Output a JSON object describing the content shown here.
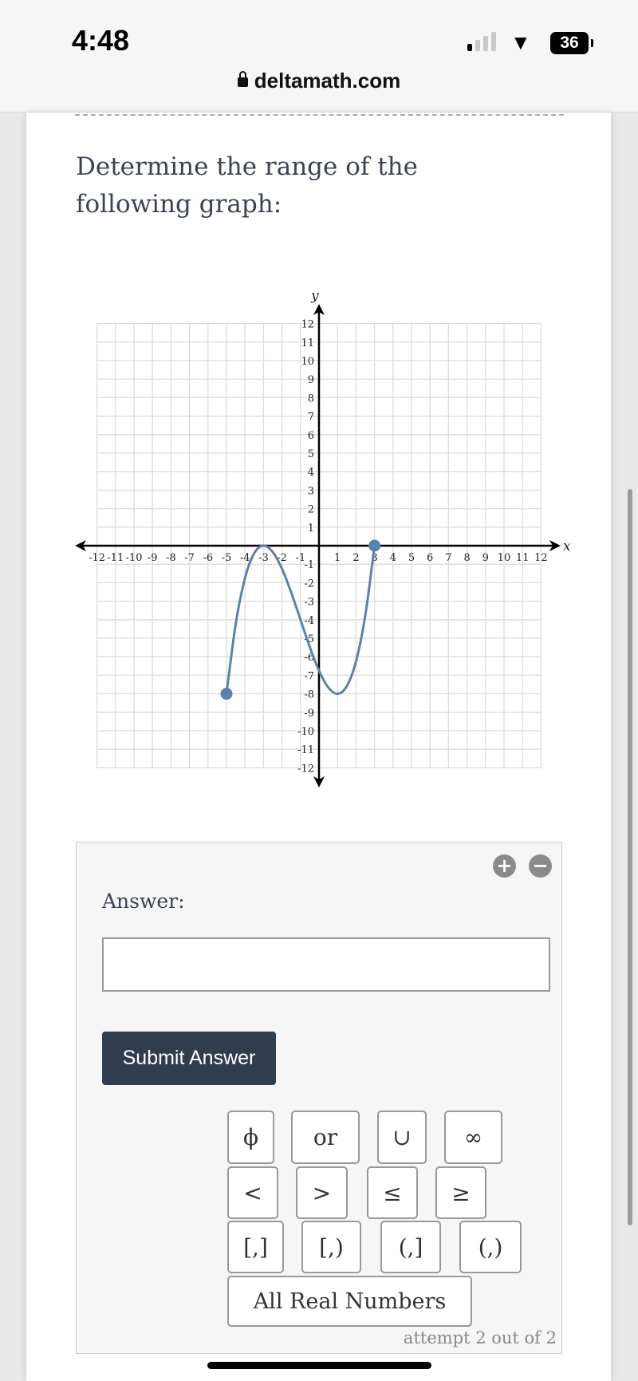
{
  "status_bar": {
    "time": "4:48",
    "battery": "36",
    "signal_icon": "cellular-signal-icon",
    "wifi_icon": "wifi-icon"
  },
  "browser": {
    "url": "deltamath.com",
    "lock_icon": "lock-icon"
  },
  "question": {
    "text": "Determine the range of the following graph:"
  },
  "chart_data": {
    "type": "line",
    "xlabel": "x",
    "ylabel": "y",
    "xlim": [
      -12,
      12
    ],
    "ylim": [
      -12,
      12
    ],
    "grid": true,
    "x_ticks": [
      -12,
      -11,
      -10,
      -9,
      -8,
      -7,
      -6,
      -5,
      -4,
      -3,
      -2,
      -1,
      1,
      2,
      3,
      4,
      5,
      6,
      7,
      8,
      9,
      10,
      11,
      12
    ],
    "y_ticks": [
      -12,
      -11,
      -10,
      -9,
      -8,
      -7,
      -6,
      -5,
      -4,
      -3,
      -2,
      -1,
      1,
      2,
      3,
      4,
      5,
      6,
      7,
      8,
      9,
      10,
      11,
      12
    ],
    "curve_color": "#5b82ad",
    "series": [
      {
        "x": [
          -5,
          -4.5,
          -4,
          -3.5,
          -3,
          -2.5,
          -2,
          -1.5,
          -1,
          -0.5,
          0,
          0.5,
          1,
          1.5,
          2,
          2.5,
          3
        ],
        "y": [
          -8,
          -4.219,
          -1.75,
          -0.406,
          0,
          -0.344,
          -1.25,
          -2.531,
          -4,
          -5.469,
          -6.75,
          -7.656,
          -8,
          -7.594,
          -6.25,
          -3.781,
          0
        ]
      }
    ],
    "endpoints": [
      {
        "x": -5,
        "y": -8,
        "closed": true
      },
      {
        "x": 3,
        "y": 0,
        "closed": true
      }
    ]
  },
  "answer": {
    "label": "Answer:",
    "value": "",
    "plus_label": "+",
    "minus_label": "−",
    "submit_label": "Submit Answer",
    "keypad": [
      {
        "label": "ϕ",
        "name": "empty-set-key"
      },
      {
        "label": "or",
        "name": "or-key"
      },
      {
        "label": "∪",
        "name": "union-key"
      },
      {
        "label": "∞",
        "name": "infinity-key"
      },
      {
        "label": "<",
        "name": "less-than-key"
      },
      {
        "label": ">",
        "name": "greater-than-key"
      },
      {
        "label": "≤",
        "name": "less-equal-key"
      },
      {
        "label": "≥",
        "name": "greater-equal-key"
      },
      {
        "label": "[,]",
        "name": "closed-interval-key"
      },
      {
        "label": "[,)",
        "name": "closed-open-interval-key"
      },
      {
        "label": "(,]",
        "name": "open-closed-interval-key"
      },
      {
        "label": "(,)",
        "name": "open-interval-key"
      },
      {
        "label": "All Real Numbers",
        "name": "all-real-numbers-key"
      }
    ],
    "attempt_text": "attempt 2 out of 2"
  }
}
